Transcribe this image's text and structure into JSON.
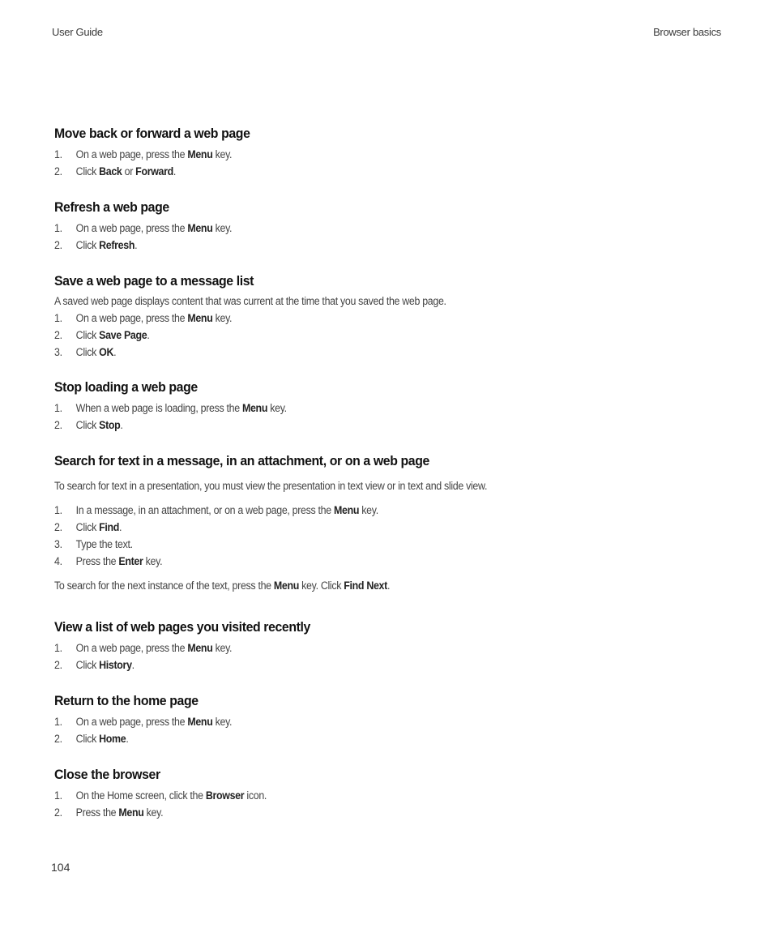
{
  "header": {
    "left": "User Guide",
    "right": "Browser basics"
  },
  "footer": {
    "page_number": "104"
  },
  "sections": [
    {
      "title": "Move back or forward a web page",
      "steps": [
        {
          "num": "1.",
          "parts": [
            "On a web page, press the ",
            "Menu",
            " key."
          ]
        },
        {
          "num": "2.",
          "parts": [
            "Click ",
            "Back",
            " or ",
            "Forward",
            "."
          ]
        }
      ]
    },
    {
      "title": "Refresh a web page",
      "steps": [
        {
          "num": "1.",
          "parts": [
            "On a web page, press the ",
            "Menu",
            " key."
          ]
        },
        {
          "num": "2.",
          "parts": [
            "Click ",
            "Refresh",
            "."
          ]
        }
      ]
    },
    {
      "title": "Save a web page to a message list",
      "intro": "A saved web page displays content that was current at the time that you saved the web page.",
      "steps": [
        {
          "num": "1.",
          "parts": [
            "On a web page, press the ",
            "Menu",
            " key."
          ]
        },
        {
          "num": "2.",
          "parts": [
            "Click ",
            "Save Page",
            "."
          ]
        },
        {
          "num": "3.",
          "parts": [
            "Click ",
            "OK",
            "."
          ]
        }
      ]
    },
    {
      "title": "Stop loading a web page",
      "steps": [
        {
          "num": "1.",
          "parts": [
            "When a web page is loading, press the ",
            "Menu",
            " key."
          ]
        },
        {
          "num": "2.",
          "parts": [
            "Click ",
            "Stop",
            "."
          ]
        }
      ]
    },
    {
      "title": "Search for text in a message, in an attachment, or on a web page",
      "intro": "To search for text in a presentation, you must view the presentation in text view or in text and slide view.",
      "steps": [
        {
          "num": "1.",
          "parts": [
            "In a message, in an attachment, or on a web page, press the ",
            "Menu",
            " key."
          ]
        },
        {
          "num": "2.",
          "parts": [
            "Click ",
            "Find",
            "."
          ]
        },
        {
          "num": "3.",
          "parts": [
            "Type the text."
          ]
        },
        {
          "num": "4.",
          "parts": [
            "Press the ",
            "Enter",
            " key."
          ]
        }
      ],
      "outro": [
        "To search for the next instance of the text, press the ",
        "Menu",
        " key. Click ",
        "Find Next",
        "."
      ]
    },
    {
      "title": "View a list of web pages you visited recently",
      "steps": [
        {
          "num": "1.",
          "parts": [
            "On a web page, press the ",
            "Menu",
            " key."
          ]
        },
        {
          "num": "2.",
          "parts": [
            "Click ",
            "History",
            "."
          ]
        }
      ]
    },
    {
      "title": "Return to the home page",
      "steps": [
        {
          "num": "1.",
          "parts": [
            "On a web page, press the ",
            "Menu",
            " key."
          ]
        },
        {
          "num": "2.",
          "parts": [
            "Click ",
            "Home",
            "."
          ]
        }
      ]
    },
    {
      "title": "Close the browser",
      "steps": [
        {
          "num": "1.",
          "parts": [
            "On the Home screen, click the ",
            "Browser",
            " icon."
          ]
        },
        {
          "num": "2.",
          "parts": [
            "Press the ",
            "Menu",
            " key."
          ]
        }
      ]
    }
  ]
}
